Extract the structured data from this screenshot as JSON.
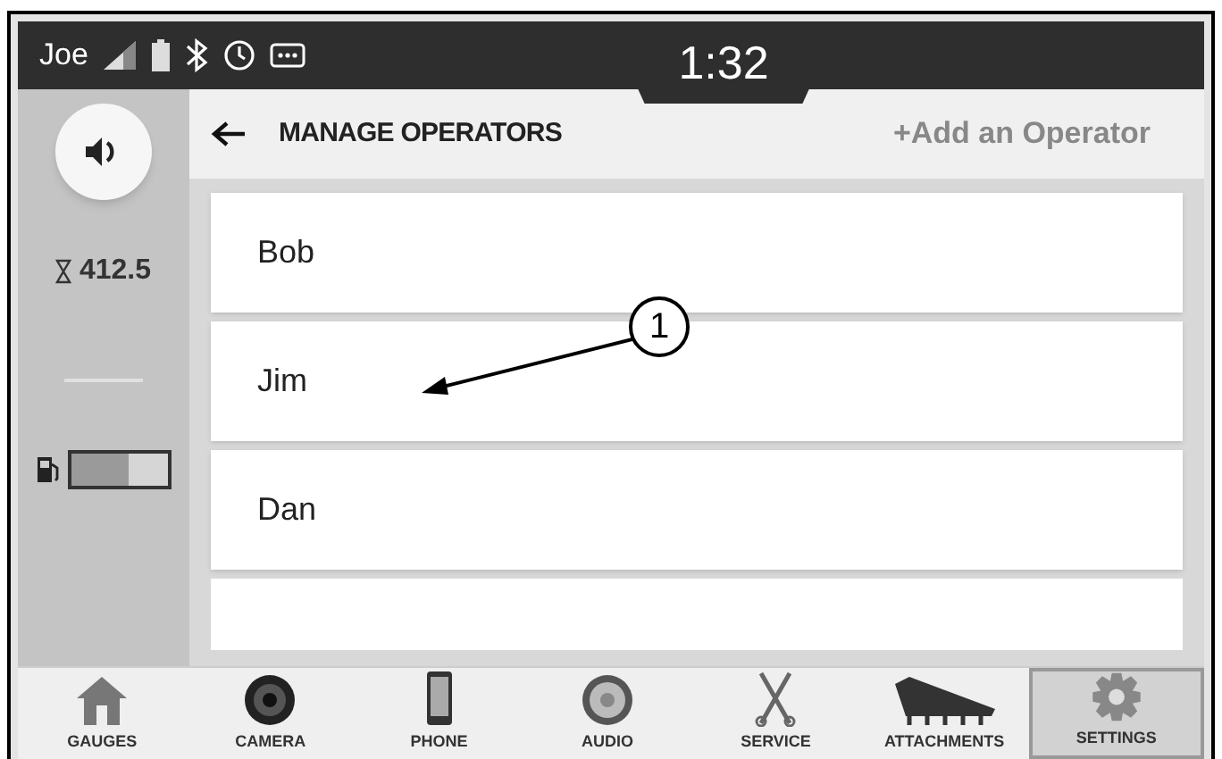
{
  "status_bar": {
    "user": "Joe",
    "time": "1:32"
  },
  "side_panel": {
    "hours": "412.5",
    "fuel": {
      "level": 0.6
    }
  },
  "header": {
    "title": "MANAGE OPERATORS",
    "action": "+Add an Operator"
  },
  "operators": [
    {
      "name": "Bob",
      "cut_off": false
    },
    {
      "name": "Jim",
      "cut_off": false
    },
    {
      "name": "Dan",
      "cut_off": false
    },
    {
      "cut_off": true
    }
  ],
  "callout": {
    "label": "1"
  },
  "nav": [
    {
      "label": "GAUGES",
      "kind": "gauges",
      "selected": false
    },
    {
      "label": "CAMERA",
      "kind": "camera",
      "selected": false
    },
    {
      "label": "PHONE",
      "kind": "phone",
      "selected": false
    },
    {
      "label": "AUDIO",
      "kind": "audio",
      "selected": false
    },
    {
      "label": "SERVICE",
      "kind": "service",
      "selected": false
    },
    {
      "label": "ATTACHMENTS",
      "kind": "attachments",
      "selected": false
    },
    {
      "label": "SETTINGS",
      "kind": "settings",
      "selected": true
    }
  ]
}
